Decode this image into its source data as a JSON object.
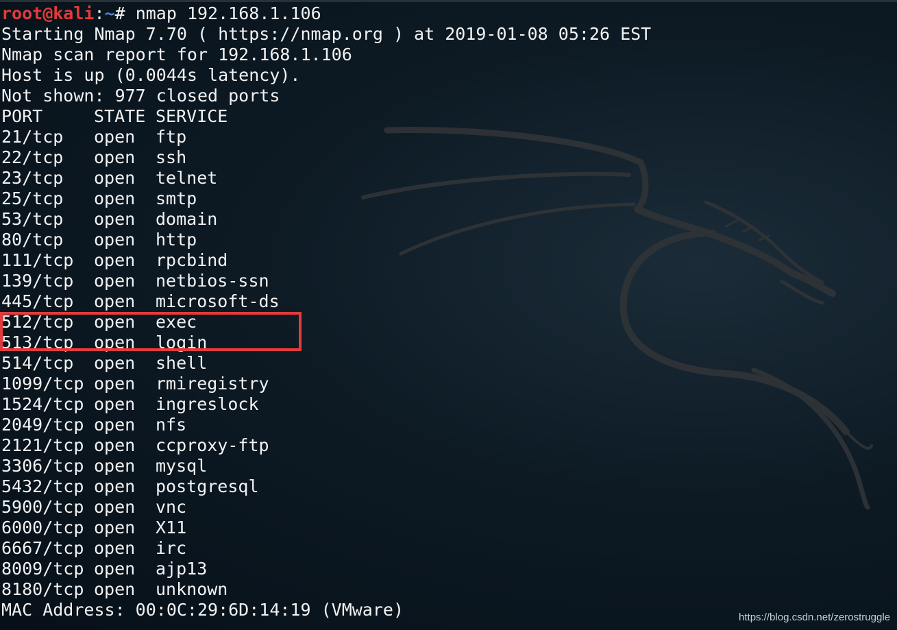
{
  "terminal": {
    "prompt": {
      "user_host": "root@kali",
      "separator": ":",
      "path": "~",
      "symbol": "# ",
      "command": "nmap 192.168.1.106"
    },
    "header_lines": [
      "Starting Nmap 7.70 ( https://nmap.org ) at 2019-01-08 05:26 EST",
      "Nmap scan report for 192.168.1.106",
      "Host is up (0.0044s latency).",
      "Not shown: 977 closed ports"
    ],
    "table_headers": {
      "port": "PORT",
      "state": "STATE",
      "service": "SERVICE"
    },
    "ports": [
      {
        "port": "21/tcp",
        "state": "open",
        "service": "ftp"
      },
      {
        "port": "22/tcp",
        "state": "open",
        "service": "ssh"
      },
      {
        "port": "23/tcp",
        "state": "open",
        "service": "telnet"
      },
      {
        "port": "25/tcp",
        "state": "open",
        "service": "smtp"
      },
      {
        "port": "53/tcp",
        "state": "open",
        "service": "domain"
      },
      {
        "port": "80/tcp",
        "state": "open",
        "service": "http"
      },
      {
        "port": "111/tcp",
        "state": "open",
        "service": "rpcbind"
      },
      {
        "port": "139/tcp",
        "state": "open",
        "service": "netbios-ssn"
      },
      {
        "port": "445/tcp",
        "state": "open",
        "service": "microsoft-ds"
      },
      {
        "port": "512/tcp",
        "state": "open",
        "service": "exec"
      },
      {
        "port": "513/tcp",
        "state": "open",
        "service": "login"
      },
      {
        "port": "514/tcp",
        "state": "open",
        "service": "shell"
      },
      {
        "port": "1099/tcp",
        "state": "open",
        "service": "rmiregistry"
      },
      {
        "port": "1524/tcp",
        "state": "open",
        "service": "ingreslock"
      },
      {
        "port": "2049/tcp",
        "state": "open",
        "service": "nfs"
      },
      {
        "port": "2121/tcp",
        "state": "open",
        "service": "ccproxy-ftp"
      },
      {
        "port": "3306/tcp",
        "state": "open",
        "service": "mysql"
      },
      {
        "port": "5432/tcp",
        "state": "open",
        "service": "postgresql"
      },
      {
        "port": "5900/tcp",
        "state": "open",
        "service": "vnc"
      },
      {
        "port": "6000/tcp",
        "state": "open",
        "service": "X11"
      },
      {
        "port": "6667/tcp",
        "state": "open",
        "service": "irc"
      },
      {
        "port": "8009/tcp",
        "state": "open",
        "service": "ajp13"
      },
      {
        "port": "8180/tcp",
        "state": "open",
        "service": "unknown"
      }
    ],
    "footer_line": "MAC Address: 00:0C:29:6D:14:19 (VMware)"
  },
  "annotation": {
    "highlighted_ports": [
      "512/tcp",
      "513/tcp"
    ],
    "color": "#e23b3b"
  },
  "watermark": "https://blog.csdn.net/zerostruggle",
  "colors": {
    "background": "#0d1a24",
    "text": "#f2f2f2",
    "prompt_user": "#e43a3a",
    "prompt_path": "#4f7fd8"
  },
  "background_logo": "kali-dragon-icon"
}
